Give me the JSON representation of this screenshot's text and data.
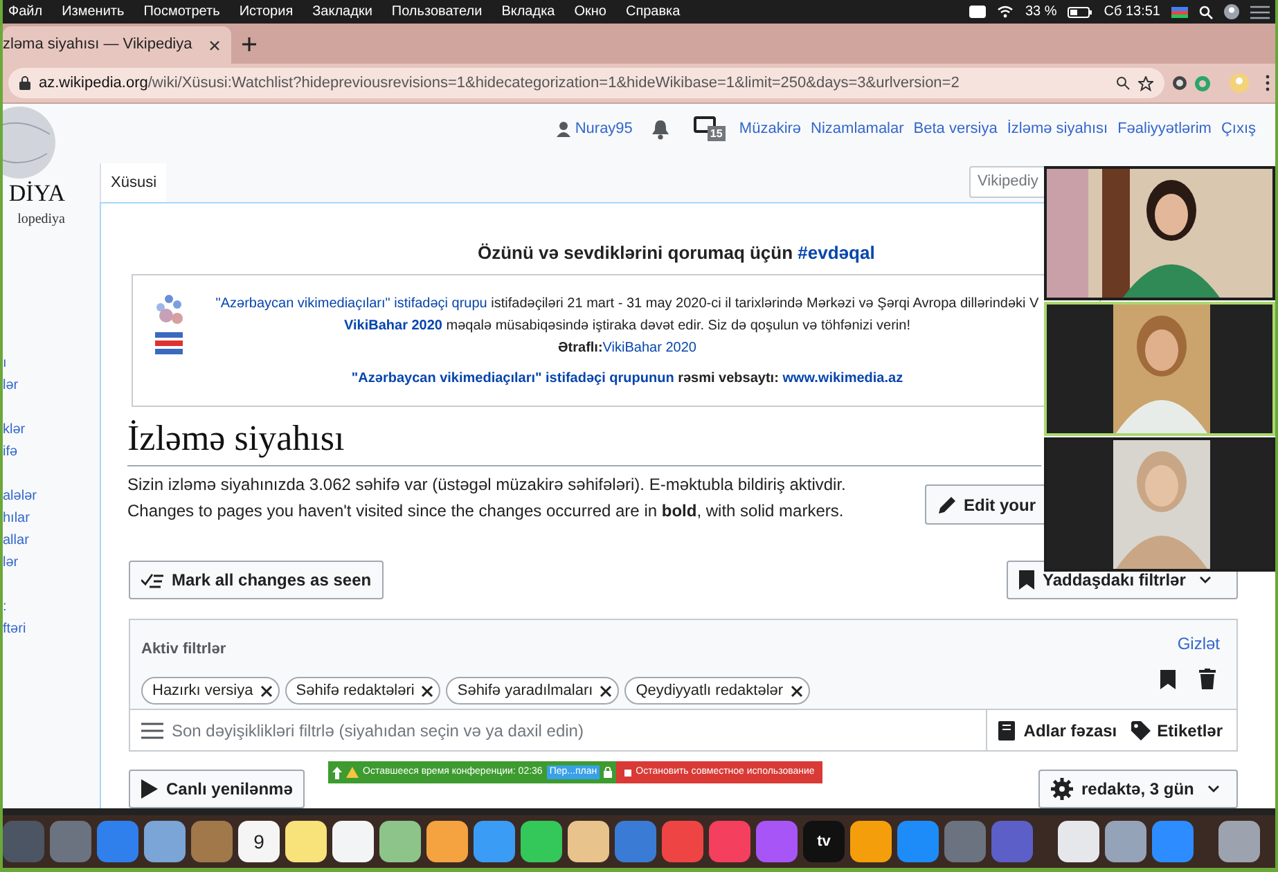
{
  "menu_bar": {
    "items": [
      "Файл",
      "Изменить",
      "Посмотреть",
      "История",
      "Закладки",
      "Пользователи",
      "Вкладка",
      "Окно",
      "Справка"
    ],
    "battery": "33 %",
    "clock": "Сб 13:51"
  },
  "browser": {
    "tab": {
      "title": "zləma siyahısı — Vikipediya"
    },
    "url_domain": "az.wikipedia.org",
    "url_path": "/wiki/Xüsusi:Watchlist?hidepreviousrevisions=1&hidecategorization=1&hideWikibase=1&limit=250&days=3&urlversion=2"
  },
  "wiki": {
    "logo": {
      "wordmark": "DİYA",
      "tagline": "lopediya"
    },
    "sidebar_sections": [
      [
        "ı",
        "lər"
      ],
      [
        "klər",
        "ifə"
      ],
      [
        "alələr",
        "hılar",
        "allar",
        "lər"
      ],
      [
        ":",
        "ftəri"
      ]
    ],
    "personal": {
      "user": "Nuray95",
      "notice_count": "15",
      "links": [
        "Müzakirə",
        "Nizamlamalar",
        "Beta versiya",
        "İzləmə siyahısı",
        "Fəaliyyətlərim",
        "Çıxış"
      ]
    },
    "tabs": [
      {
        "label": "Xüsusi",
        "selected": true
      }
    ],
    "search": {
      "placeholder": "Vikipediy"
    },
    "banner": {
      "title": "Özünü və sevdiklərini qorumaq üçün",
      "hashtag": "#evdəqal",
      "lines": [
        [
          {
            "text": "\"Azərbaycan vikimediaçıları\" istifadəçi qrupu",
            "link": true,
            "bold": false
          },
          {
            "text": " istifadəçiləri 21 mart - 31 may 2020-ci il tarixlərində Mərkəzi və Şərqi Avropa dillərindəki V",
            "link": false,
            "bold": false
          }
        ],
        [
          {
            "text": "VikiBahar 2020",
            "link": true,
            "bold": true
          },
          {
            "text": " məqalə müsabiqəsində iştiraka dəvət edir. Siz də qoşulun və töhfənizi verin!",
            "link": false,
            "bold": false
          }
        ],
        [
          {
            "text": "Ətraflı:",
            "link": false,
            "bold": true
          },
          {
            "text": "VikiBahar 2020",
            "link": true,
            "bold": false
          }
        ],
        [
          {
            "text": "\"Azərbaycan vikimediaçıları\" istifadəçi qrupunun",
            "link": true,
            "bold": true
          },
          {
            "text": " rəsmi vebsaytı: ",
            "link": false,
            "bold": true
          },
          {
            "text": "www.wikimedia.az",
            "link": true,
            "bold": true
          }
        ]
      ]
    },
    "heading": "İzləmə siyahısı",
    "paragraphs": [
      "Sizin izləmə siyahınızda 3.062 səhifə var (üstəgəl müzakirə səhifələri). E-məktubla bildiriş aktivdir.",
      "Changes to pages you haven't visited since the changes occurred are in **bold**, with solid markers."
    ],
    "edit_button": "Edit your",
    "mark_seen_button": "Mark all changes as seen",
    "saved_filters_button": "Yaddaşdakı filtrlər",
    "filters": {
      "title": "Aktiv filtrlər",
      "hide_link": "Gizlət",
      "chips": [
        "Hazırkı versiya",
        "Səhifə redaktələri",
        "Səhifə yaradılmaları",
        "Qeydiyyatlı redaktələr"
      ],
      "placeholder": "Son dəyişiklikləri filtrlə (siyahıdan seçin və ya daxil edin)",
      "namespaces_button": "Adlar fəzası",
      "tags_button": "Etiketlər"
    },
    "live_button": "Canlı yenilənmə",
    "period_button": "redaktə, 3 gün"
  },
  "conference_bar": {
    "remaining": "Оставшееся время конференции: 02:36",
    "plan": "Пер...план",
    "stop": "Остановить совместное использование"
  },
  "video_tiles": [
    {
      "active_speaker": false
    },
    {
      "active_speaker": true
    },
    {
      "active_speaker": false
    }
  ],
  "dock": [
    {
      "color": "#4b5563"
    },
    {
      "color": "#6b7280"
    },
    {
      "color": "#2f80ed"
    },
    {
      "color": "#7aa5d6"
    },
    {
      "color": "#a0784a"
    },
    {
      "color": "#f5f5f5",
      "label": "9"
    },
    {
      "color": "#f8e27a"
    },
    {
      "color": "#f3f4f6"
    },
    {
      "color": "#8cc48a"
    },
    {
      "color": "#f4a340"
    },
    {
      "color": "#3b9cf5"
    },
    {
      "color": "#34c759"
    },
    {
      "color": "#e8c38b"
    },
    {
      "color": "#3a7bd5"
    },
    {
      "color": "#ef4444"
    },
    {
      "color": "#f43f5e"
    },
    {
      "color": "#a855f7"
    },
    {
      "color": "#111111",
      "label": "tv"
    },
    {
      "color": "#f59e0b"
    },
    {
      "color": "#1d8cf8"
    },
    {
      "color": "#6b7280"
    },
    {
      "color": "#5b5fc7"
    },
    {
      "color": "#e5e7eb"
    },
    {
      "color": "#94a3b8"
    },
    {
      "color": "#2d8cff"
    },
    {
      "color": "#9ca3af"
    }
  ]
}
